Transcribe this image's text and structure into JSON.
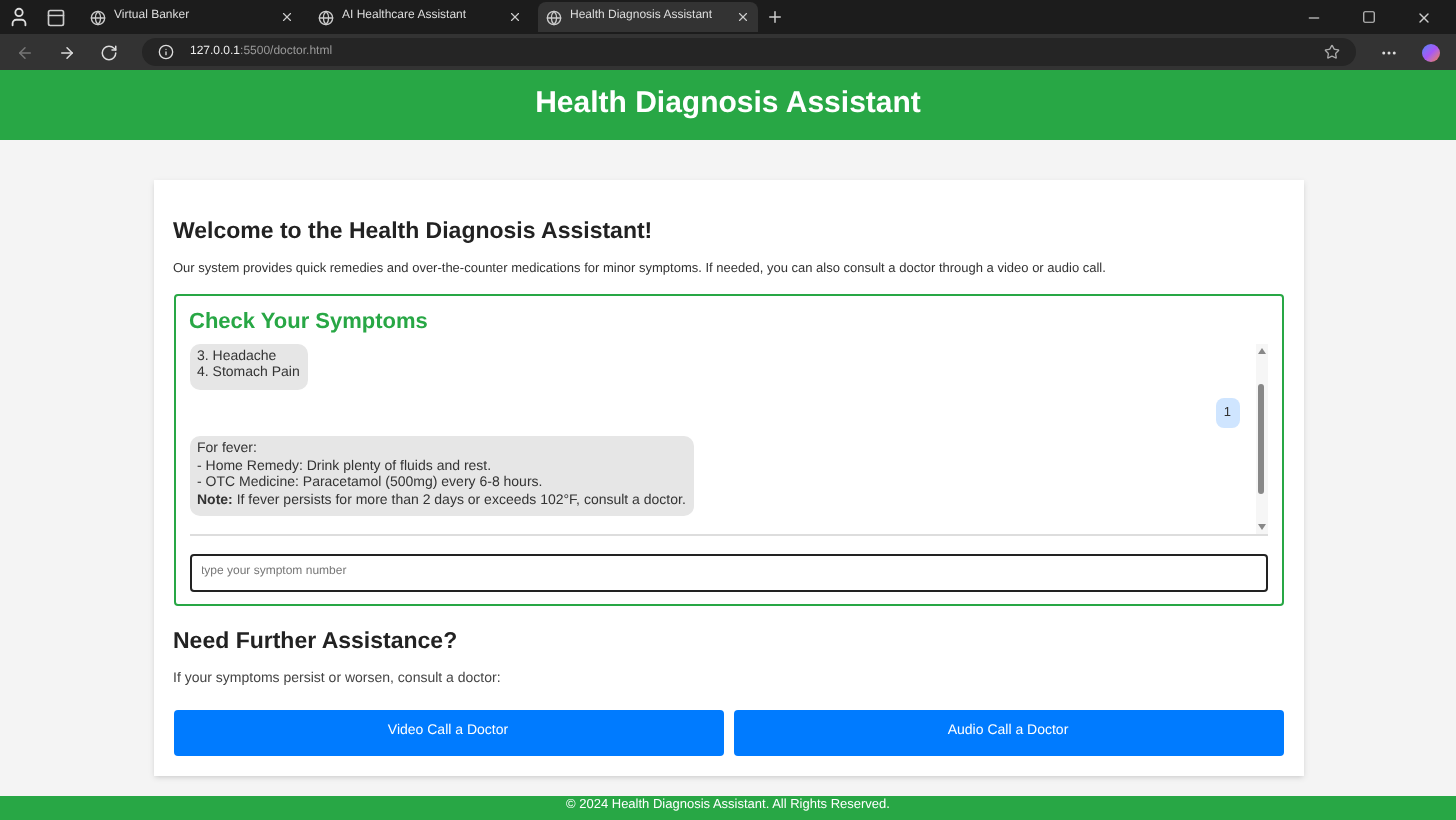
{
  "browser": {
    "tabs": [
      {
        "title": "Virtual Banker",
        "selected": false
      },
      {
        "title": "AI Healthcare Assistant",
        "selected": false
      },
      {
        "title": "Health Diagnosis Assistant",
        "selected": true
      }
    ],
    "address": {
      "host": "127.0.0.1",
      "rest": ":5500/doctor.html"
    }
  },
  "header": {
    "title": "Health Diagnosis Assistant"
  },
  "intro": {
    "title": "Welcome to the Health Diagnosis Assistant!",
    "text": "Our system provides quick remedies and over-the-counter medications for minor symptoms. If needed, you can also consult a doctor through a video or audio call."
  },
  "chat": {
    "title": "Check Your Symptoms",
    "messages": [
      {
        "kind": "bot",
        "lines": [
          "3. Headache",
          "4. Stomach Pain"
        ]
      },
      {
        "kind": "user",
        "lines": [
          "1"
        ]
      },
      {
        "kind": "bot",
        "lines": [
          "For fever:",
          "- Home Remedy: Drink plenty of fluids and rest.",
          "- OTC Medicine: Paracetamol (500mg) every 6-8 hours.",
          "**Note:** If fever persists for more than 2 days or exceeds 102°F, consult a doctor."
        ]
      }
    ],
    "input": {
      "placeholder": "type your symptom number"
    }
  },
  "assistance": {
    "title": "Need Further Assistance?",
    "text": "If your symptoms persist or worsen, consult a doctor:",
    "buttons": [
      "Video Call a Doctor",
      "Audio Call a Doctor"
    ]
  },
  "footer": {
    "text": "© 2024 Health Diagnosis Assistant. All Rights Reserved."
  }
}
